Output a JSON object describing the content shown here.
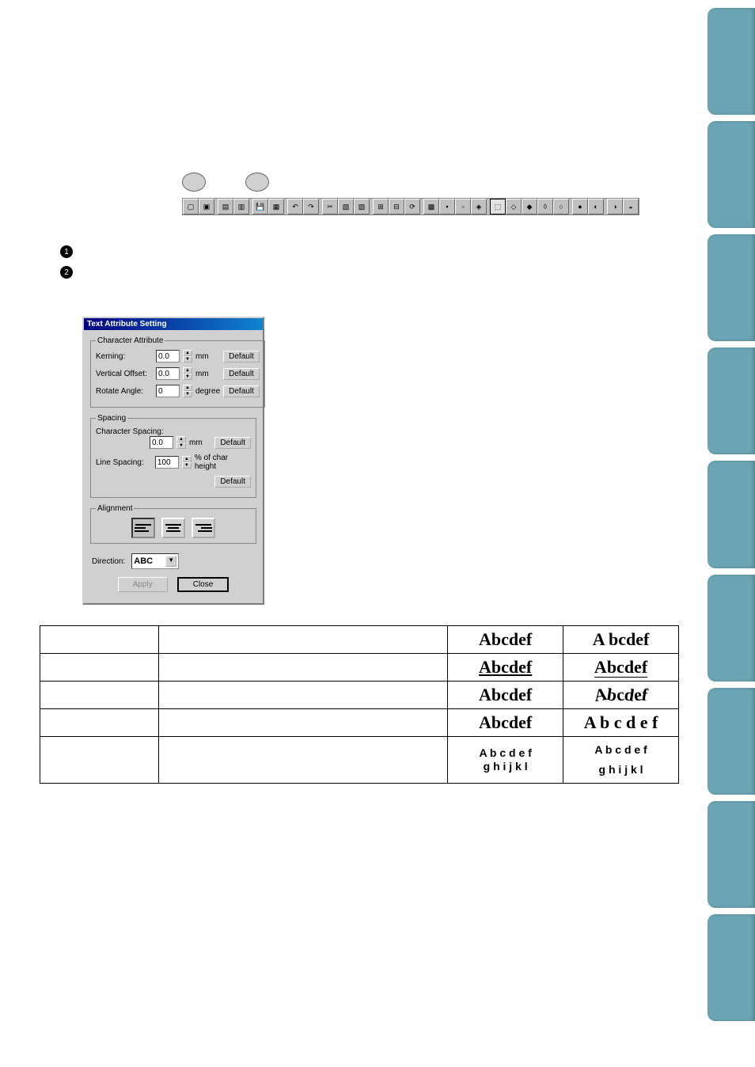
{
  "dialog": {
    "title": "Text Attribute Setting",
    "groups": {
      "character_attribute": {
        "legend": "Character Attribute",
        "kerning": {
          "label": "Kerning:",
          "value": "0.0",
          "unit": "mm",
          "default_btn": "Default"
        },
        "vertical_offset": {
          "label": "Vertical Offset:",
          "value": "0.0",
          "unit": "mm",
          "default_btn": "Default"
        },
        "rotate_angle": {
          "label": "Rotate Angle:",
          "value": "0",
          "unit": "degree",
          "default_btn": "Default"
        }
      },
      "spacing": {
        "legend": "Spacing",
        "character_spacing": {
          "label": "Character Spacing:",
          "value": "0.0",
          "unit": "mm",
          "default_btn": "Default"
        },
        "line_spacing": {
          "label": "Line Spacing:",
          "value": "100",
          "unit": "% of char height",
          "default_btn": "Default"
        }
      },
      "alignment": {
        "legend": "Alignment"
      }
    },
    "direction": {
      "label": "Direction:",
      "value": "ABC"
    },
    "buttons": {
      "apply": "Apply",
      "close": "Close"
    }
  },
  "bullets": {
    "b1": "1",
    "b2": "2"
  },
  "table": {
    "samples": {
      "s1a": "Abcdef",
      "s1b": "A bcdef",
      "s2a": "Abcdef",
      "s2b": "Abcdef",
      "s3a": "Abcdef",
      "s3b": "Abcdef",
      "s4a": "Abcdef",
      "s4b": "A b c d e f",
      "s5a_l1": "A b c d e f",
      "s5a_l2": "g h i j k l",
      "s5b_l1": "A b c d e f",
      "s5b_l2": "g h i j k l"
    }
  }
}
